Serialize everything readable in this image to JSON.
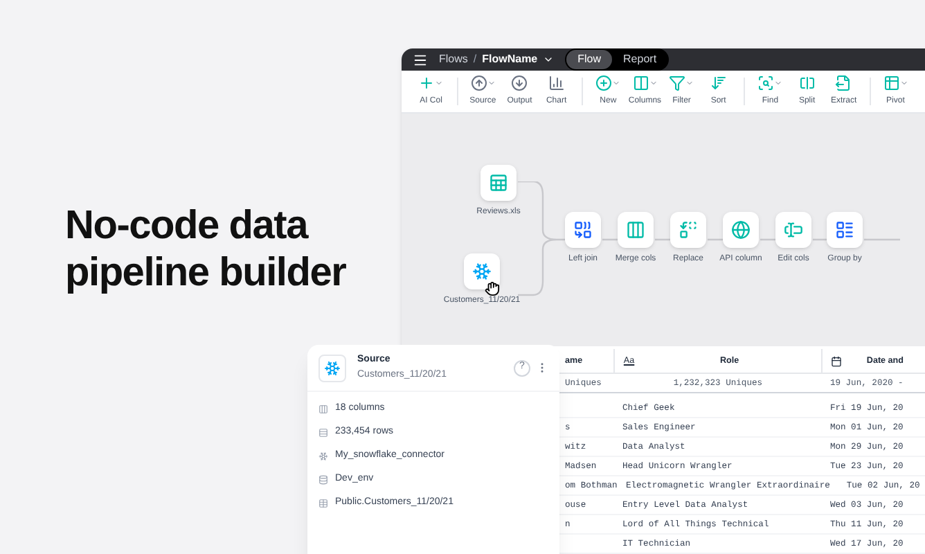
{
  "headline": "No-code data pipeline builder",
  "app": {
    "breadcrumb": {
      "parent": "Flows",
      "separator": "/",
      "current": "FlowName"
    },
    "view_tabs": [
      {
        "label": "Flow",
        "selected": true
      },
      {
        "label": "Report",
        "selected": false
      }
    ],
    "toolbar": [
      {
        "label": "AI Col",
        "kind": "ai",
        "dropdown": true,
        "separator_before": false
      },
      {
        "label": "Source",
        "kind": "source",
        "dropdown": true,
        "separator_before": true
      },
      {
        "label": "Output",
        "kind": "output",
        "dropdown": false,
        "separator_before": false
      },
      {
        "label": "Chart",
        "kind": "chart",
        "dropdown": false,
        "separator_before": false
      },
      {
        "label": "New",
        "kind": "new",
        "dropdown": true,
        "separator_before": true
      },
      {
        "label": "Columns",
        "kind": "columns",
        "dropdown": true,
        "separator_before": false
      },
      {
        "label": "Filter",
        "kind": "filter",
        "dropdown": true,
        "separator_before": false
      },
      {
        "label": "Sort",
        "kind": "sort",
        "dropdown": false,
        "separator_before": false
      },
      {
        "label": "Find",
        "kind": "find",
        "dropdown": true,
        "separator_before": true
      },
      {
        "label": "Split",
        "kind": "split",
        "dropdown": false,
        "separator_before": false
      },
      {
        "label": "Extract",
        "kind": "extract",
        "dropdown": false,
        "separator_before": false
      },
      {
        "label": "Pivot",
        "kind": "pivot",
        "dropdown": true,
        "separator_before": true
      }
    ],
    "nodes": [
      {
        "label": "Reviews.xls",
        "kind": "sheet"
      },
      {
        "label": "Customers_11/20/21",
        "kind": "snowflake"
      },
      {
        "label": "Left join",
        "kind": "join"
      },
      {
        "label": "Merge cols",
        "kind": "merge"
      },
      {
        "label": "Replace",
        "kind": "replace"
      },
      {
        "label": "API column",
        "kind": "api"
      },
      {
        "label": "Edit cols",
        "kind": "edit"
      },
      {
        "label": "Group by",
        "kind": "group"
      }
    ],
    "source_panel": {
      "title": "Source",
      "subtitle": "Customers_11/20/21",
      "help": "?",
      "details": [
        {
          "kind": "columns",
          "text": "18 columns"
        },
        {
          "kind": "rows",
          "text": "233,454 rows"
        },
        {
          "kind": "connector",
          "text": "My_snowflake_connector"
        },
        {
          "kind": "database",
          "text": "Dev_env"
        },
        {
          "kind": "table",
          "text": "Public.Customers_11/20/21"
        }
      ]
    },
    "table": {
      "columns": [
        {
          "label": "ame",
          "kind": "plain"
        },
        {
          "label": "Role",
          "kind": "text",
          "type_label": "Aa"
        },
        {
          "label": "Date and",
          "kind": "date"
        }
      ],
      "summary": [
        "Uniques",
        "1,232,323 Uniques",
        "19 Jun, 2020 -"
      ],
      "rows": [
        {
          "role": "Chief Geek",
          "date": "Fri 19 Jun, 20"
        },
        {
          "name": "s",
          "role": "Sales Engineer",
          "date": "Mon 01 Jun, 20"
        },
        {
          "name": "witz",
          "role": "Data Analyst",
          "date": "Mon 29 Jun, 20"
        },
        {
          "name": "Madsen",
          "role": "Head Unicorn Wrangler",
          "date": "Tue 23 Jun, 20"
        },
        {
          "name": "om Bothman",
          "role": "Electromagnetic Wrangler Extraordinaire",
          "date": "Tue 02 Jun, 20"
        },
        {
          "name": "ouse",
          "role": "Entry Level Data Analyst",
          "date": "Wed 03 Jun, 20"
        },
        {
          "name": "n",
          "role": "Lord of All Things Technical",
          "date": "Thu 11 Jun, 20"
        },
        {
          "role": "IT Technician",
          "date": "Wed 17 Jun, 20"
        }
      ]
    }
  }
}
